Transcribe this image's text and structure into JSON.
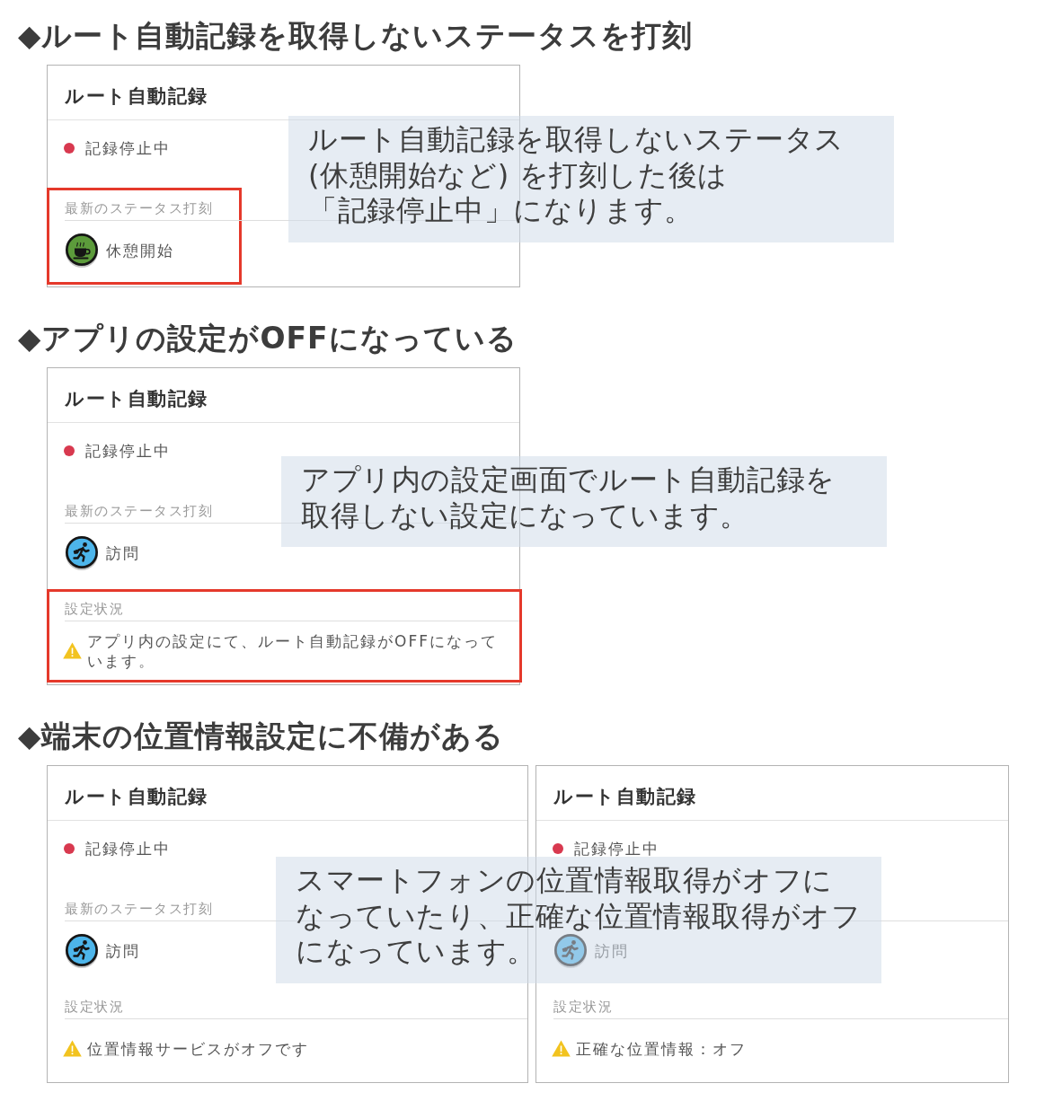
{
  "sections": [
    {
      "heading": "◆ルート自動記録を取得しないステータスを打刻",
      "cards": [
        {
          "title": "ルート自動記録",
          "status": {
            "kind": "stopped",
            "label": "記録停止中"
          },
          "blocks": [
            {
              "kind": "stamp",
              "label": "最新のステータス打刻",
              "highlighted": true,
              "item": {
                "kind": "break",
                "text": "休憩開始"
              }
            }
          ]
        }
      ],
      "callout": {
        "lines": [
          "ルート自動記録を取得しないステータス",
          "(休憩開始など) を打刻した後は",
          "「記録停止中」になります。"
        ]
      }
    },
    {
      "heading": "◆アプリの設定がOFFになっている",
      "cards": [
        {
          "title": "ルート自動記録",
          "status": {
            "kind": "stopped",
            "label": "記録停止中"
          },
          "blocks": [
            {
              "kind": "stamp",
              "label": "最新のステータス打刻",
              "highlighted": false,
              "item": {
                "kind": "visit",
                "text": "訪問"
              }
            },
            {
              "kind": "settings",
              "label": "設定状況",
              "highlighted": true,
              "item": {
                "kind": "warning",
                "text": "アプリ内の設定にて、ルート自動記録がOFFになっています。"
              }
            }
          ]
        }
      ],
      "callout": {
        "lines": [
          "アプリ内の設定画面でルート自動記録を",
          "取得しない設定になっています。"
        ]
      }
    },
    {
      "heading": "◆端末の位置情報設定に不備がある",
      "cards": [
        {
          "title": "ルート自動記録",
          "status": {
            "kind": "stopped",
            "label": "記録停止中"
          },
          "blocks": [
            {
              "kind": "stamp",
              "label": "最新のステータス打刻",
              "highlighted": false,
              "item": {
                "kind": "visit",
                "text": "訪問"
              }
            },
            {
              "kind": "settings",
              "label": "設定状況",
              "highlighted": false,
              "item": {
                "kind": "warning",
                "text": "位置情報サービスがオフです"
              }
            }
          ]
        },
        {
          "title": "ルート自動記録",
          "status": {
            "kind": "stopped",
            "label": "記録停止中"
          },
          "blocks": [
            {
              "kind": "stamp",
              "highlighted": false,
              "item": {
                "kind": "visit",
                "text": "訪問"
              }
            },
            {
              "kind": "settings",
              "label": "設定状況",
              "highlighted": false,
              "item": {
                "kind": "warning",
                "text": "正確な位置情報：オフ"
              }
            }
          ]
        }
      ],
      "callout": {
        "lines": [
          "スマートフォンの位置情報取得がオフに",
          "なっていたり、正確な位置情報取得がオフ",
          "になっています。"
        ]
      }
    }
  ]
}
